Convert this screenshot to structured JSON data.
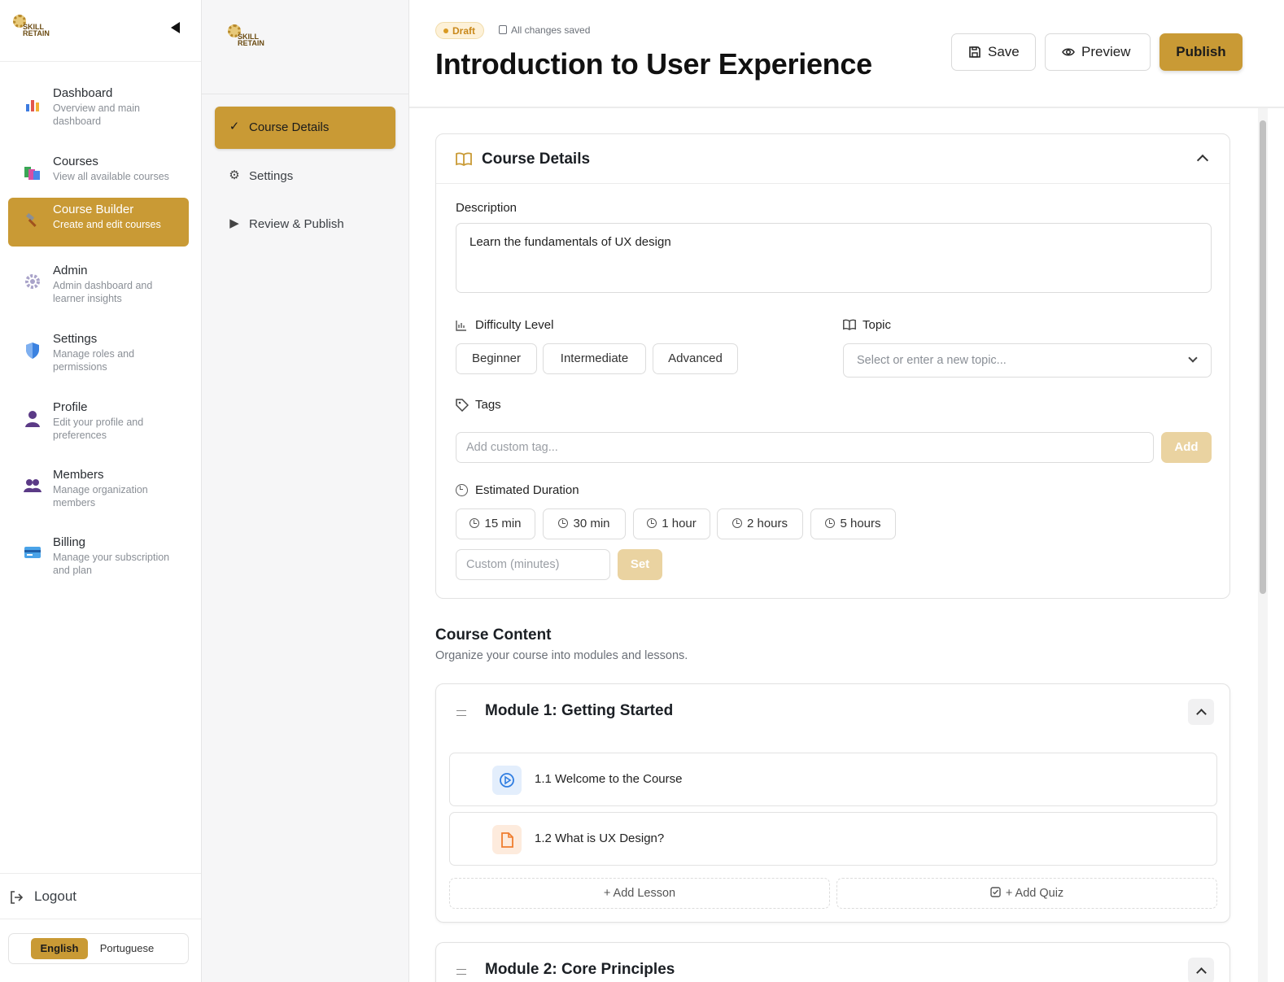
{
  "nav": {
    "items": [
      {
        "title": "Dashboard",
        "subtitle": "Overview and main dashboard"
      },
      {
        "title": "Courses",
        "subtitle": "View all available courses"
      },
      {
        "title": "Course Builder",
        "subtitle": "Create and edit courses"
      },
      {
        "title": "Admin",
        "subtitle": "Admin dashboard and learner insights"
      },
      {
        "title": "Settings",
        "subtitle": "Manage roles and permissions"
      },
      {
        "title": "Profile",
        "subtitle": "Edit your profile and preferences"
      },
      {
        "title": "Members",
        "subtitle": "Manage organization members"
      },
      {
        "title": "Billing",
        "subtitle": "Manage your subscription and plan"
      }
    ],
    "logout": "Logout",
    "languages": [
      "English",
      "Portuguese"
    ],
    "active_language": "English"
  },
  "brand": {
    "name_line1": "SKILL",
    "name_line2": "RETAIN",
    "accent": "#c99a35"
  },
  "steps": [
    {
      "label": "Course Details",
      "icon": "check-icon"
    },
    {
      "label": "Settings",
      "icon": "gear-icon"
    },
    {
      "label": "Review & Publish",
      "icon": "play-icon"
    }
  ],
  "header": {
    "status": "Draft",
    "saved_text": "All changes saved",
    "title": "Introduction to User Experience",
    "save_label": "Save",
    "preview_label": "Preview",
    "publish_label": "Publish"
  },
  "details": {
    "title": "Course Details",
    "description_label": "Description",
    "description_value": "Learn the fundamentals of UX design",
    "difficulty_label": "Difficulty Level",
    "difficulty_options": [
      "Beginner",
      "Intermediate",
      "Advanced"
    ],
    "topic_label": "Topic",
    "topic_placeholder": "Select or enter a new topic...",
    "tags_label": "Tags",
    "tag_placeholder": "Add custom tag...",
    "tag_add_label": "Add",
    "duration_label": "Estimated Duration",
    "duration_options": [
      "15 min",
      "30 min",
      "1 hour",
      "2 hours",
      "5 hours"
    ],
    "custom_placeholder": "Custom (minutes)",
    "set_label": "Set"
  },
  "content": {
    "title": "Course Content",
    "subtitle": "Organize your course into modules and lessons.",
    "modules": [
      {
        "title": "Module 1: Getting Started",
        "lessons": [
          {
            "name": "1.1 Welcome to the Course",
            "icon": "play-circle-icon",
            "color": "#2f7de1"
          },
          {
            "name": "1.2 What is UX Design?",
            "icon": "document-icon",
            "color": "#ef7d2e"
          }
        ],
        "add_lesson": "+ Add Lesson",
        "add_quiz": "+ Add Quiz"
      },
      {
        "title": "Module 2: Core Principles"
      }
    ]
  }
}
